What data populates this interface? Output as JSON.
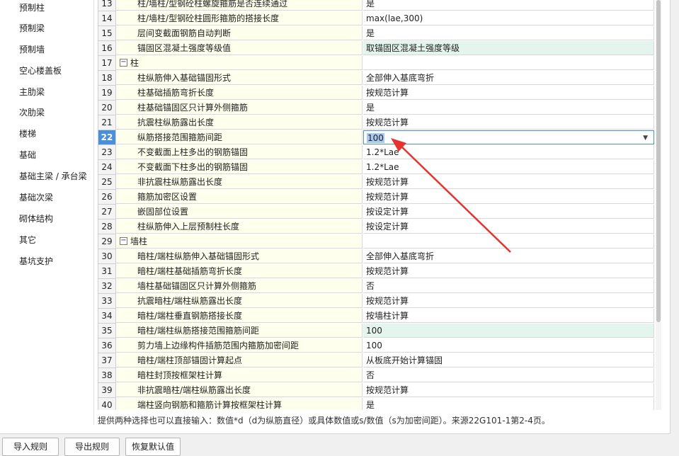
{
  "sidebar": {
    "items": [
      "预制柱",
      "预制梁",
      "预制墙",
      "空心楼盖板",
      "主肋梁",
      "次肋梁",
      "楼梯",
      "基础",
      "基础主梁 / 承台梁",
      "基础次梁",
      "砌体结构",
      "其它",
      "基坑支护"
    ]
  },
  "rows": [
    {
      "num": "13",
      "name": "柱/墙柱/型钢砼柱螺旋箍筋是否连续通过",
      "value": "是"
    },
    {
      "num": "14",
      "name": "柱/墙柱/型钢砼柱圆形箍筋的搭接长度",
      "value": "max(lae,300)"
    },
    {
      "num": "15",
      "name": "层间变截面钢筋自动判断",
      "value": "是"
    },
    {
      "num": "16",
      "name": "锚固区混凝土强度等级值",
      "value": "取锚固区混凝土强度等级"
    },
    {
      "num": "17",
      "name": "柱",
      "value": ""
    },
    {
      "num": "18",
      "name": "柱纵筋伸入基础锚固形式",
      "value": "全部伸入基底弯折"
    },
    {
      "num": "19",
      "name": "柱基础插筋弯折长度",
      "value": "按规范计算"
    },
    {
      "num": "20",
      "name": "柱基础锚固区只计算外侧箍筋",
      "value": "是"
    },
    {
      "num": "21",
      "name": "抗震柱纵筋露出长度",
      "value": "按规范计算"
    },
    {
      "num": "22",
      "name": "纵筋搭接范围箍筋间距",
      "value": "100"
    },
    {
      "num": "23",
      "name": "不变截面上柱多出的钢筋锚固",
      "value": "1.2*Lae"
    },
    {
      "num": "24",
      "name": "不变截面下柱多出的钢筋锚固",
      "value": "1.2*Lae"
    },
    {
      "num": "25",
      "name": "非抗震柱纵筋露出长度",
      "value": "按规范计算"
    },
    {
      "num": "26",
      "name": "箍筋加密区设置",
      "value": "按规范计算"
    },
    {
      "num": "27",
      "name": "嵌固部位设置",
      "value": "按设定计算"
    },
    {
      "num": "28",
      "name": "柱纵筋伸入上层预制柱长度",
      "value": "按设定计算"
    },
    {
      "num": "29",
      "name": "墙柱",
      "value": ""
    },
    {
      "num": "30",
      "name": "暗柱/端柱纵筋伸入基础锚固形式",
      "value": "全部伸入基底弯折"
    },
    {
      "num": "31",
      "name": "暗柱/端柱基础插筋弯折长度",
      "value": "按规范计算"
    },
    {
      "num": "32",
      "name": "墙柱基础锚固区只计算外侧箍筋",
      "value": "否"
    },
    {
      "num": "33",
      "name": "抗震暗柱/端柱纵筋露出长度",
      "value": "按规范计算"
    },
    {
      "num": "34",
      "name": "暗柱/端柱垂直钢筋搭接长度",
      "value": "按墙柱计算"
    },
    {
      "num": "35",
      "name": "暗柱/端柱纵筋搭接范围箍筋间距",
      "value": "100"
    },
    {
      "num": "36",
      "name": "剪力墙上边缘构件插筋范围内箍筋加密间距",
      "value": "100"
    },
    {
      "num": "37",
      "name": "暗柱/端柱顶部锚固计算起点",
      "value": "从板底开始计算锚固"
    },
    {
      "num": "38",
      "name": "暗柱封顶按框架柱计算",
      "value": "否"
    },
    {
      "num": "39",
      "name": "非抗震暗柱/端柱纵筋露出长度",
      "value": "按规范计算"
    },
    {
      "num": "40",
      "name": "端柱竖向钢筋和箍筋计算按框架柱计算",
      "value": "是"
    }
  ],
  "hint": "提供两种选择也可以直接输入：数值*d（d为纵筋直径）或具体数值或s/数值（s为加密间距）。来源22G101-1第2-4页。",
  "buttons": {
    "import": "导入规则",
    "export": "导出规则",
    "restore": "恢复默认值"
  },
  "colors": {
    "accent": "#4a90d9",
    "name_bg": "#ffffee",
    "highlight": "#e3f5ec",
    "arrow": "#e8322d"
  }
}
